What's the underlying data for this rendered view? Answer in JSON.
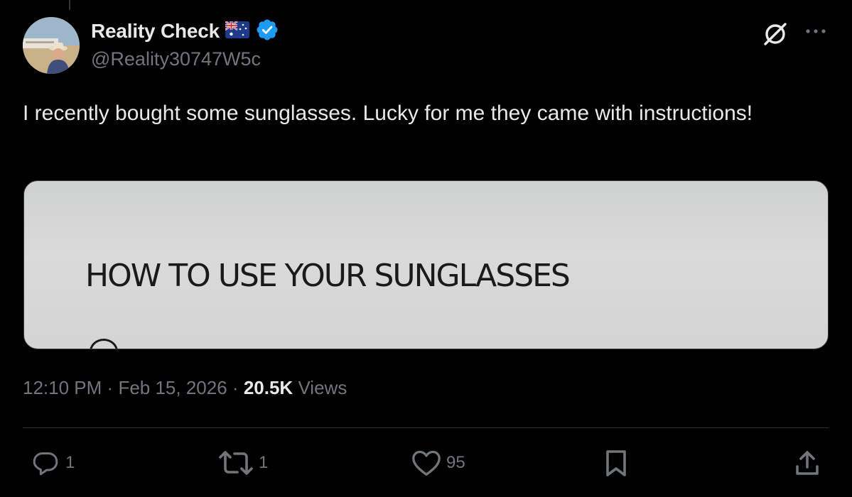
{
  "author": {
    "display_name": "Reality Check",
    "handle": "@Reality30747W5c",
    "flag_icon": "australia-flag-icon",
    "verified_icon": "verified-badge-icon",
    "verified_color": "#1d9bf0"
  },
  "tweet": {
    "text": "I recently bought some sunglasses. Lucky for me they came with instructions!"
  },
  "media": {
    "image_text": "HOW TO USE YOUR SUNGLASSES"
  },
  "meta": {
    "time": "12:10 PM",
    "date": "Feb 15, 2026",
    "views_count": "20.5K",
    "views_label": "Views",
    "separator": "·"
  },
  "actions": {
    "reply_count": "1",
    "repost_count": "1",
    "like_count": "95"
  },
  "colors": {
    "background": "#000000",
    "text_primary": "#e7e9ea",
    "text_secondary": "#71767b",
    "divider": "#2f3336"
  }
}
